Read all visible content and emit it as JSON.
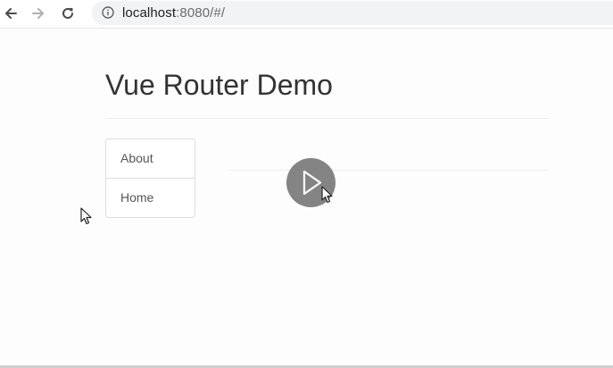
{
  "browser": {
    "icons": {
      "back": "back-arrow-icon",
      "forward": "forward-arrow-icon",
      "reload": "reload-icon",
      "site_info": "info-icon"
    },
    "url_host": "localhost",
    "url_rest": ":8080/#/"
  },
  "page": {
    "title": "Vue Router Demo",
    "nav_items": [
      {
        "label": "About"
      },
      {
        "label": "Home"
      }
    ]
  },
  "overlay": {
    "icon": "play-icon"
  },
  "colors": {
    "title_text": "#333333",
    "link_text": "#555555",
    "omnibox_bg": "#f1f3f4",
    "overlay_bg": "#6e6e6e"
  }
}
